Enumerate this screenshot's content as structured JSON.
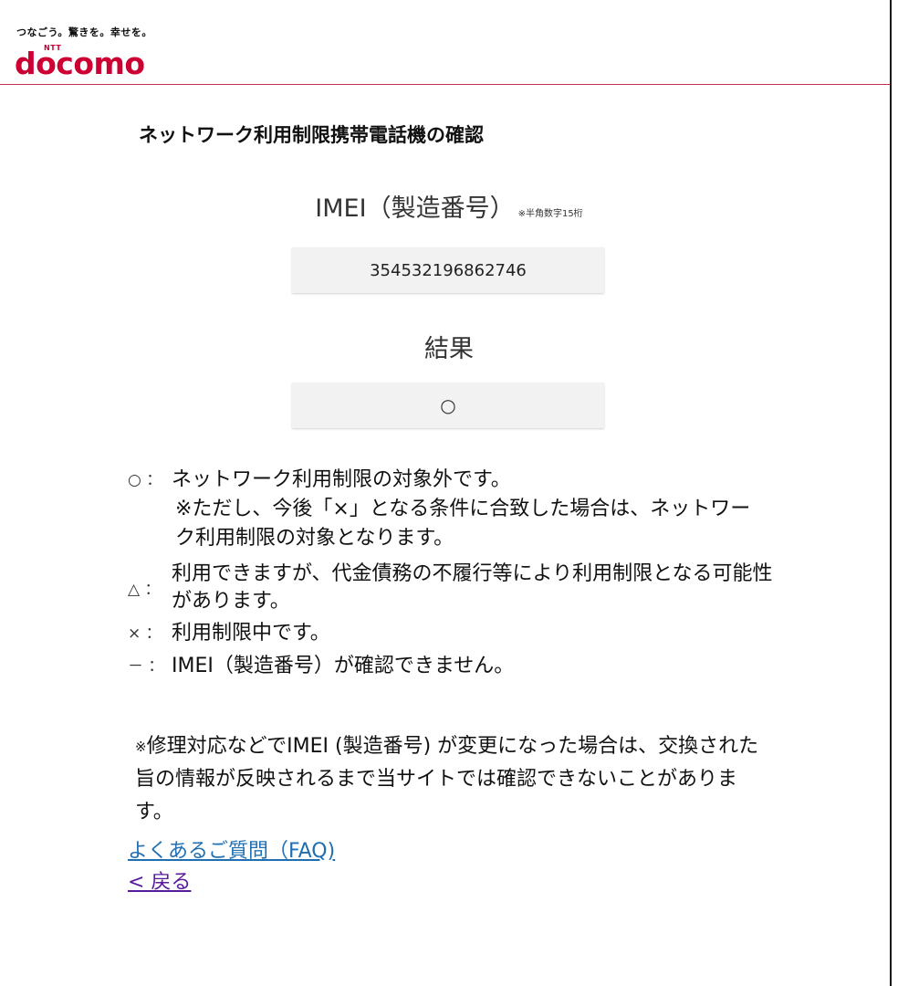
{
  "header": {
    "tagline": "つなごう。驚きを。幸せを。",
    "logo_ntt": "NTT",
    "logo_text": "docomo",
    "brand_color": "#cc0033"
  },
  "page_title": "ネットワーク利用制限携帯電話機の確認",
  "imei": {
    "label": "IMEI（製造番号）",
    "note": "※半角数字15桁",
    "value": "354532196862746"
  },
  "result": {
    "label": "結果",
    "value": "○"
  },
  "legend": {
    "circle": {
      "symbol": "○",
      "sep": "：",
      "text": "ネットワーク利用制限の対象外です。",
      "note": "※ただし、今後「×」となる条件に合致した場合は、ネットワーク利用制限の対象となります。"
    },
    "triangle": {
      "symbol": "△",
      "sep": "：",
      "text": "利用できますが、代金債務の不履行等により利用制限となる可能性があります。"
    },
    "cross": {
      "symbol": "×",
      "sep": "：",
      "text": "利用制限中です。"
    },
    "dash": {
      "symbol": "－",
      "sep": "：",
      "text": "IMEI（製造番号）が確認できません。"
    }
  },
  "footnote": {
    "mark": "※",
    "text": "修理対応などでIMEI (製造番号) が変更になった場合は、交換された旨の情報が反映されるまで当サイトでは確認できないことがあります。"
  },
  "links": {
    "faq": "よくあるご質問（FAQ)",
    "back": "< 戻る"
  }
}
